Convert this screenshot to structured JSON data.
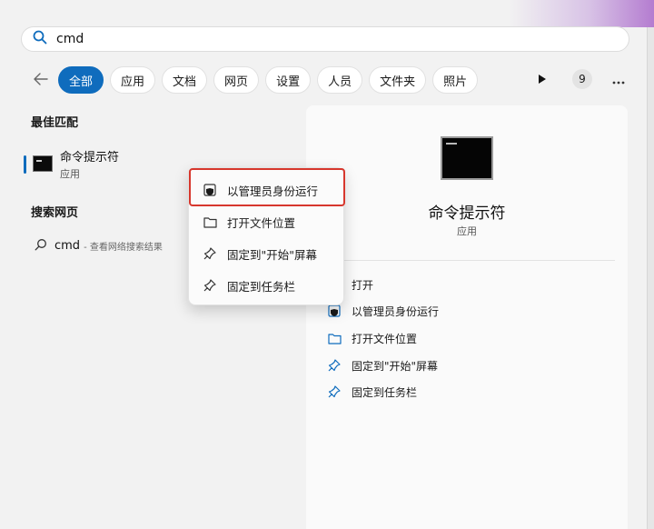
{
  "search": {
    "query": "cmd"
  },
  "filters": {
    "chips": [
      "全部",
      "应用",
      "文档",
      "网页",
      "设置",
      "人员",
      "文件夹",
      "照片"
    ],
    "active": 0,
    "badge": "9"
  },
  "best_match": {
    "title": "最佳匹配",
    "item": {
      "name": "命令提示符",
      "type": "应用",
      "icon": "cmd-icon"
    }
  },
  "web_search": {
    "title": "搜索网页",
    "item": {
      "query": "cmd",
      "sub": "- 查看网络搜索结果"
    }
  },
  "context_menu": {
    "items": [
      {
        "label": "以管理员身份运行",
        "icon": "shield-icon"
      },
      {
        "label": "打开文件位置",
        "icon": "folder-icon"
      },
      {
        "label": "固定到\"开始\"屏幕",
        "icon": "pin-icon"
      },
      {
        "label": "固定到任务栏",
        "icon": "pin-icon"
      }
    ]
  },
  "details": {
    "name": "命令提示符",
    "type": "应用",
    "actions": [
      {
        "label": "打开",
        "icon": "open-icon"
      },
      {
        "label": "以管理员身份运行",
        "icon": "shield-icon"
      },
      {
        "label": "打开文件位置",
        "icon": "folder-icon"
      },
      {
        "label": "固定到\"开始\"屏幕",
        "icon": "pin-icon"
      },
      {
        "label": "固定到任务栏",
        "icon": "pin-icon"
      }
    ]
  },
  "colors": {
    "accent": "#0f6cbd",
    "highlight": "#d7372d"
  }
}
